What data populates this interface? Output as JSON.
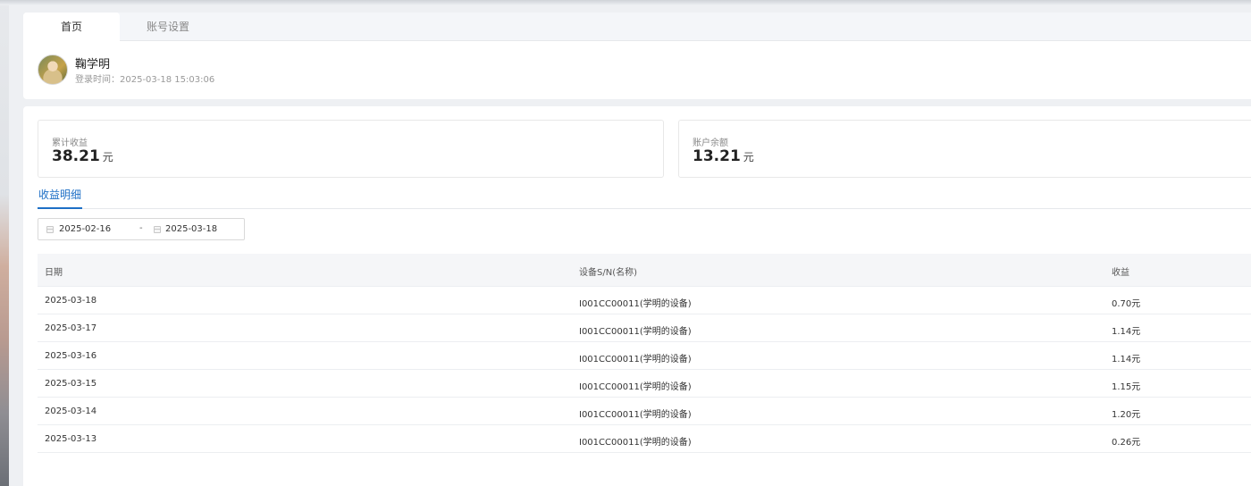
{
  "header": {
    "tabs": [
      {
        "label": "首页",
        "active": true
      },
      {
        "label": "账号设置",
        "active": false
      }
    ],
    "user": {
      "name": "鞠学明",
      "login_time": "登录时间：2025-03-18 15:03:06"
    }
  },
  "stats": {
    "total_earnings": {
      "label": "累计收益",
      "value": "38.21",
      "unit": "元"
    },
    "balance": {
      "label": "账户余额",
      "value": "13.21",
      "unit": "元"
    }
  },
  "detail_tab": {
    "label": "收益明细"
  },
  "date_range": {
    "start": "2025-02-16",
    "separator": "-",
    "end": "2025-03-18"
  },
  "table": {
    "headers": {
      "date": "日期",
      "device": "设备S/N(名称)",
      "earnings": "收益"
    },
    "rows": [
      {
        "date": "2025-03-18",
        "device": "I001CC00011(学明的设备)",
        "earnings": "0.70元"
      },
      {
        "date": "2025-03-17",
        "device": "I001CC00011(学明的设备)",
        "earnings": "1.14元"
      },
      {
        "date": "2025-03-16",
        "device": "I001CC00011(学明的设备)",
        "earnings": "1.14元"
      },
      {
        "date": "2025-03-15",
        "device": "I001CC00011(学明的设备)",
        "earnings": "1.15元"
      },
      {
        "date": "2025-03-14",
        "device": "I001CC00011(学明的设备)",
        "earnings": "1.20元"
      },
      {
        "date": "2025-03-13",
        "device": "I001CC00011(学明的设备)",
        "earnings": "0.26元"
      }
    ]
  },
  "colors": {
    "accent": "#1e6fc6",
    "background": "#eef0f3"
  }
}
